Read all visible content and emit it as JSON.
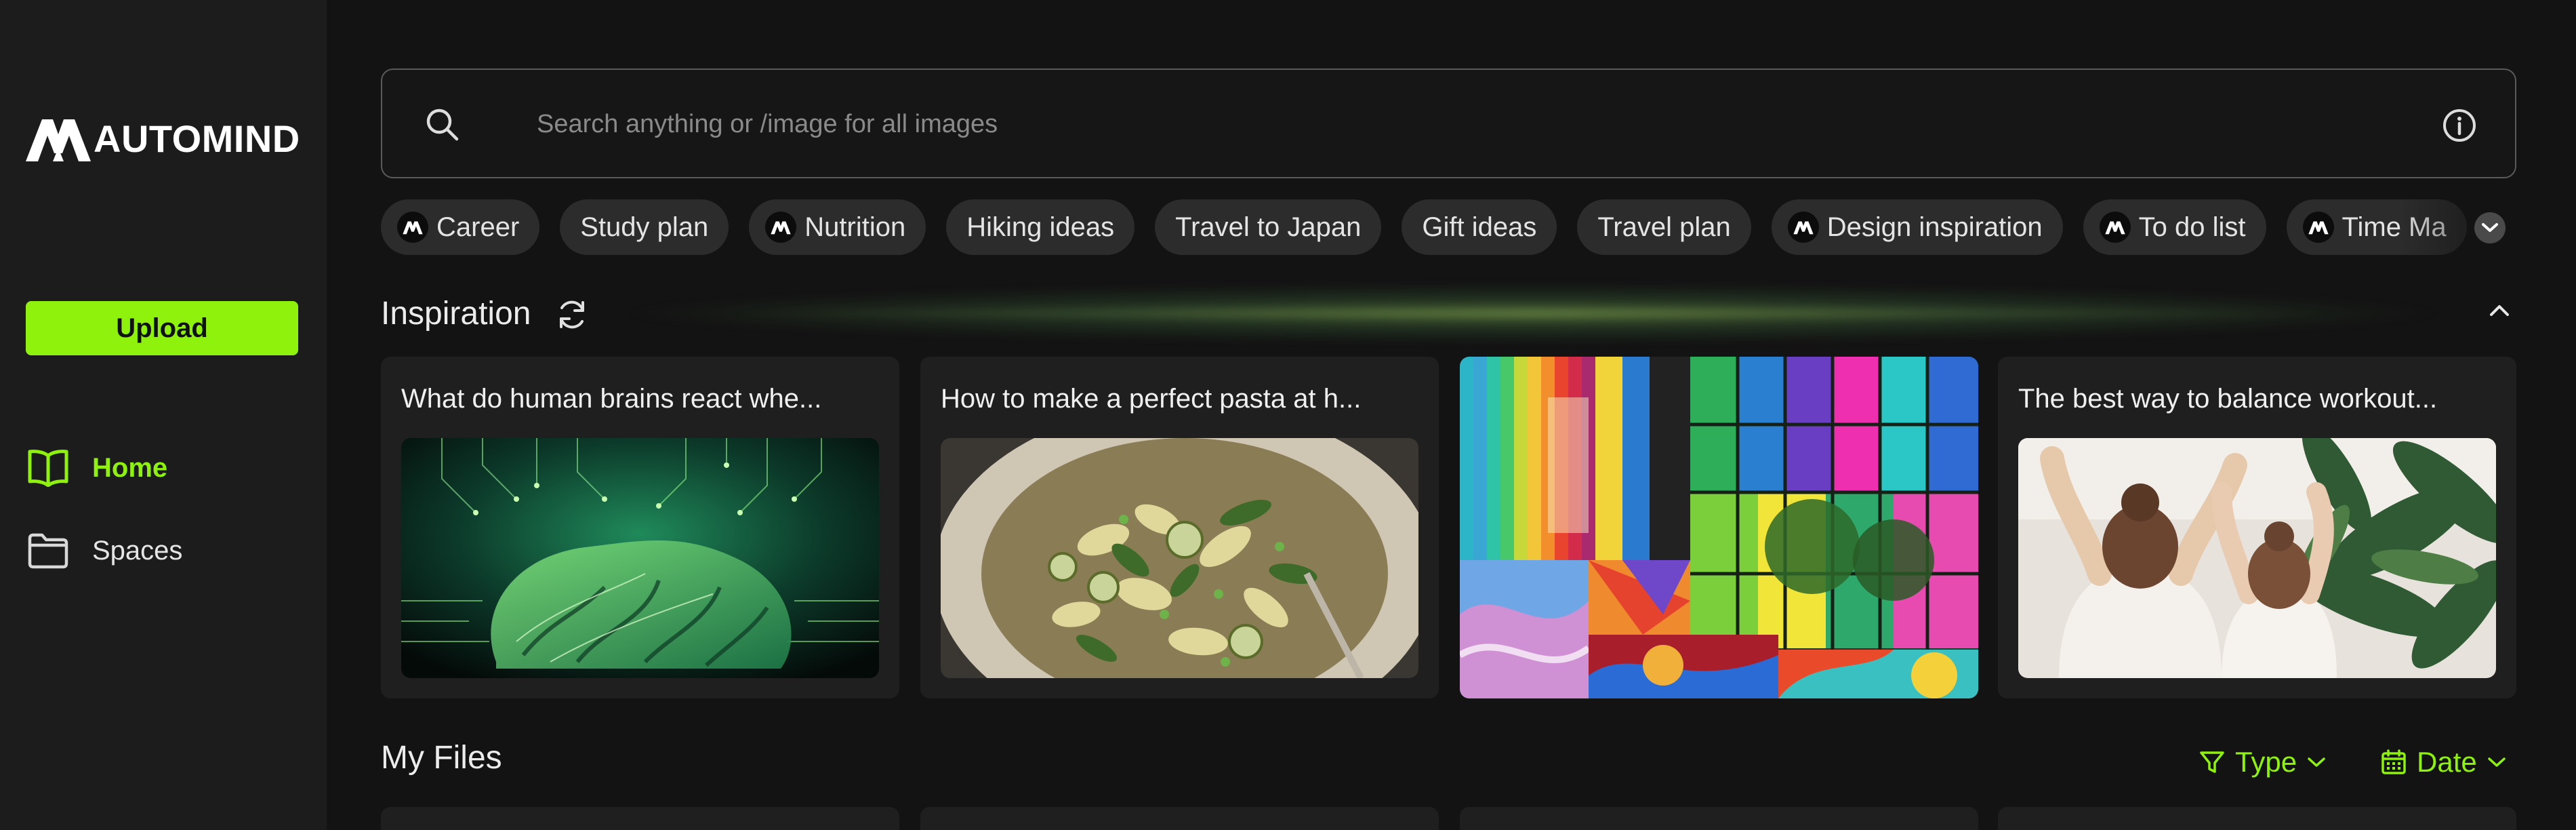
{
  "app": {
    "brand": "AUTOMIND",
    "accent_color": "#8ff20c"
  },
  "sidebar": {
    "upload_label": "Upload",
    "items": [
      {
        "label": "Home",
        "icon": "book-open-icon",
        "active": true
      },
      {
        "label": "Spaces",
        "icon": "folder-icon",
        "active": false
      }
    ]
  },
  "search": {
    "placeholder": "Search anything or /image for all images",
    "value": ""
  },
  "chips": [
    {
      "label": "Career",
      "icon": true
    },
    {
      "label": "Study plan",
      "icon": false
    },
    {
      "label": "Nutrition",
      "icon": true
    },
    {
      "label": "Hiking ideas",
      "icon": false
    },
    {
      "label": "Travel to Japan",
      "icon": false
    },
    {
      "label": "Gift ideas",
      "icon": false
    },
    {
      "label": "Travel plan",
      "icon": false
    },
    {
      "label": "Design inspiration",
      "icon": true
    },
    {
      "label": "To do list",
      "icon": true
    },
    {
      "label": "Time Ma",
      "icon": true
    }
  ],
  "inspiration": {
    "title": "Inspiration",
    "cards": [
      {
        "title": "What do human brains react whe...",
        "image": "circuit-brain-image"
      },
      {
        "title": "How to make a perfect pasta at h...",
        "image": "pasta-dish-image"
      },
      {
        "title": "",
        "image": "colorful-collage-image"
      },
      {
        "title": "The best way to balance workout...",
        "image": "yoga-stretch-image"
      }
    ]
  },
  "my_files": {
    "title": "My Files",
    "filters": {
      "type_label": "Type",
      "date_label": "Date"
    }
  }
}
